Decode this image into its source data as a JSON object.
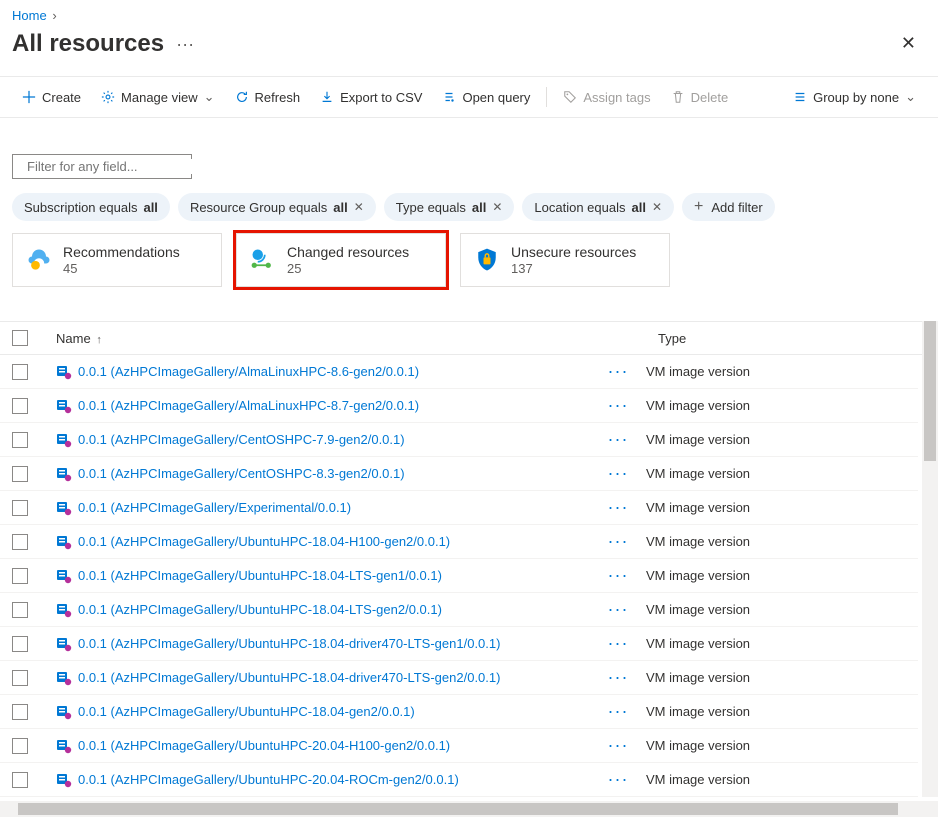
{
  "breadcrumb": {
    "home": "Home"
  },
  "page": {
    "title": "All resources"
  },
  "toolbar": {
    "create": "Create",
    "manage_view": "Manage view",
    "refresh": "Refresh",
    "export_csv": "Export to CSV",
    "open_query": "Open query",
    "assign_tags": "Assign tags",
    "delete": "Delete",
    "group_by": "Group by none"
  },
  "filters": {
    "placeholder": "Filter for any field...",
    "pills": {
      "subscription_prefix": "Subscription equals ",
      "subscription_value": "all",
      "rg_prefix": "Resource Group equals ",
      "rg_value": "all",
      "type_prefix": "Type equals ",
      "type_value": "all",
      "location_prefix": "Location equals ",
      "location_value": "all",
      "add_filter": "Add filter"
    }
  },
  "cards": {
    "recommendations": {
      "title": "Recommendations",
      "count": "45"
    },
    "changed": {
      "title": "Changed resources",
      "count": "25"
    },
    "unsecure": {
      "title": "Unsecure resources",
      "count": "137"
    }
  },
  "grid": {
    "headers": {
      "name": "Name",
      "type": "Type"
    },
    "rows": [
      {
        "name": "0.0.1 (AzHPCImageGallery/AlmaLinuxHPC-8.6-gen2/0.0.1)",
        "type": "VM image version"
      },
      {
        "name": "0.0.1 (AzHPCImageGallery/AlmaLinuxHPC-8.7-gen2/0.0.1)",
        "type": "VM image version"
      },
      {
        "name": "0.0.1 (AzHPCImageGallery/CentOSHPC-7.9-gen2/0.0.1)",
        "type": "VM image version"
      },
      {
        "name": "0.0.1 (AzHPCImageGallery/CentOSHPC-8.3-gen2/0.0.1)",
        "type": "VM image version"
      },
      {
        "name": "0.0.1 (AzHPCImageGallery/Experimental/0.0.1)",
        "type": "VM image version"
      },
      {
        "name": "0.0.1 (AzHPCImageGallery/UbuntuHPC-18.04-H100-gen2/0.0.1)",
        "type": "VM image version"
      },
      {
        "name": "0.0.1 (AzHPCImageGallery/UbuntuHPC-18.04-LTS-gen1/0.0.1)",
        "type": "VM image version"
      },
      {
        "name": "0.0.1 (AzHPCImageGallery/UbuntuHPC-18.04-LTS-gen2/0.0.1)",
        "type": "VM image version"
      },
      {
        "name": "0.0.1 (AzHPCImageGallery/UbuntuHPC-18.04-driver470-LTS-gen1/0.0.1)",
        "type": "VM image version"
      },
      {
        "name": "0.0.1 (AzHPCImageGallery/UbuntuHPC-18.04-driver470-LTS-gen2/0.0.1)",
        "type": "VM image version"
      },
      {
        "name": "0.0.1 (AzHPCImageGallery/UbuntuHPC-18.04-gen2/0.0.1)",
        "type": "VM image version"
      },
      {
        "name": "0.0.1 (AzHPCImageGallery/UbuntuHPC-20.04-H100-gen2/0.0.1)",
        "type": "VM image version"
      },
      {
        "name": "0.0.1 (AzHPCImageGallery/UbuntuHPC-20.04-ROCm-gen2/0.0.1)",
        "type": "VM image version"
      }
    ]
  }
}
